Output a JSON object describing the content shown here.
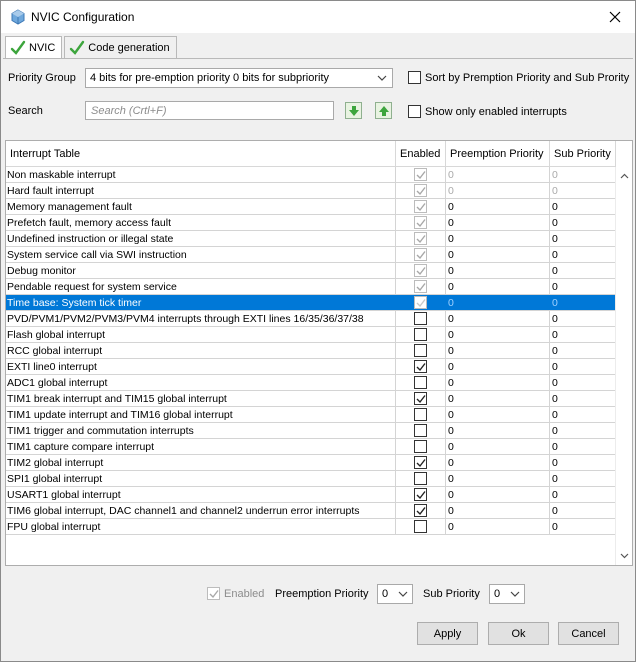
{
  "window": {
    "title": "NVIC Configuration"
  },
  "tabs": [
    {
      "label": "NVIC",
      "active": true
    },
    {
      "label": "Code generation",
      "active": false
    }
  ],
  "priority_group": {
    "label": "Priority Group",
    "value": "4 bits for pre-emption priority 0 bits for subpriority"
  },
  "sort_option": {
    "label": "Sort by Premption Priority and Sub Prority",
    "checked": false
  },
  "search": {
    "label": "Search",
    "placeholder": "Search (Crtl+F)"
  },
  "enabled_filter": {
    "label": "Show only enabled interrupts",
    "checked": false
  },
  "table": {
    "headers": [
      "Interrupt Table",
      "Enabled",
      "Preemption Priority",
      "Sub Priority"
    ],
    "rows": [
      {
        "name": "Non maskable interrupt",
        "enabled": true,
        "locked": true,
        "preemption": "0",
        "sub": "0",
        "dim": true
      },
      {
        "name": "Hard fault interrupt",
        "enabled": true,
        "locked": true,
        "preemption": "0",
        "sub": "0",
        "dim": true
      },
      {
        "name": "Memory management fault",
        "enabled": true,
        "locked": true,
        "preemption": "0",
        "sub": "0",
        "dim": false
      },
      {
        "name": "Prefetch fault, memory access fault",
        "enabled": true,
        "locked": true,
        "preemption": "0",
        "sub": "0",
        "dim": false
      },
      {
        "name": "Undefined instruction or illegal state",
        "enabled": true,
        "locked": true,
        "preemption": "0",
        "sub": "0",
        "dim": false
      },
      {
        "name": "System service call via SWI instruction",
        "enabled": true,
        "locked": true,
        "preemption": "0",
        "sub": "0",
        "dim": false
      },
      {
        "name": "Debug monitor",
        "enabled": true,
        "locked": true,
        "preemption": "0",
        "sub": "0",
        "dim": false
      },
      {
        "name": "Pendable request for system service",
        "enabled": true,
        "locked": true,
        "preemption": "0",
        "sub": "0",
        "dim": false
      },
      {
        "name": "Time base: System tick timer",
        "enabled": true,
        "locked": true,
        "preemption": "0",
        "sub": "0",
        "dim": false,
        "selected": true
      },
      {
        "name": "PVD/PVM1/PVM2/PVM3/PVM4 interrupts through EXTI lines 16/35/36/37/38",
        "enabled": false,
        "locked": false,
        "preemption": "0",
        "sub": "0",
        "dim": false
      },
      {
        "name": "Flash global interrupt",
        "enabled": false,
        "locked": false,
        "preemption": "0",
        "sub": "0",
        "dim": false
      },
      {
        "name": "RCC global interrupt",
        "enabled": false,
        "locked": false,
        "preemption": "0",
        "sub": "0",
        "dim": false
      },
      {
        "name": "EXTI line0 interrupt",
        "enabled": true,
        "locked": false,
        "preemption": "0",
        "sub": "0",
        "dim": false
      },
      {
        "name": "ADC1 global interrupt",
        "enabled": false,
        "locked": false,
        "preemption": "0",
        "sub": "0",
        "dim": false
      },
      {
        "name": "TIM1 break interrupt and TIM15 global interrupt",
        "enabled": true,
        "locked": false,
        "preemption": "0",
        "sub": "0",
        "dim": false
      },
      {
        "name": "TIM1 update interrupt and TIM16 global interrupt",
        "enabled": false,
        "locked": false,
        "preemption": "0",
        "sub": "0",
        "dim": false
      },
      {
        "name": "TIM1 trigger and commutation interrupts",
        "enabled": false,
        "locked": false,
        "preemption": "0",
        "sub": "0",
        "dim": false
      },
      {
        "name": "TIM1 capture compare interrupt",
        "enabled": false,
        "locked": false,
        "preemption": "0",
        "sub": "0",
        "dim": false
      },
      {
        "name": "TIM2 global interrupt",
        "enabled": true,
        "locked": false,
        "preemption": "0",
        "sub": "0",
        "dim": false
      },
      {
        "name": "SPI1 global interrupt",
        "enabled": false,
        "locked": false,
        "preemption": "0",
        "sub": "0",
        "dim": false
      },
      {
        "name": "USART1 global interrupt",
        "enabled": true,
        "locked": false,
        "preemption": "0",
        "sub": "0",
        "dim": false
      },
      {
        "name": "TIM6 global interrupt, DAC channel1 and channel2 underrun error interrupts",
        "enabled": true,
        "locked": false,
        "preemption": "0",
        "sub": "0",
        "dim": false
      },
      {
        "name": "FPU global interrupt",
        "enabled": false,
        "locked": false,
        "preemption": "0",
        "sub": "0",
        "dim": false
      }
    ]
  },
  "editor": {
    "enabled_label": "Enabled",
    "preemption_label": "Preemption Priority",
    "preemption_value": "0",
    "sub_label": "Sub Priority",
    "sub_value": "0"
  },
  "buttons": {
    "apply": "Apply",
    "ok": "Ok",
    "cancel": "Cancel"
  },
  "colors": {
    "selection": "#0078d7",
    "check_green": "#3da53d"
  }
}
